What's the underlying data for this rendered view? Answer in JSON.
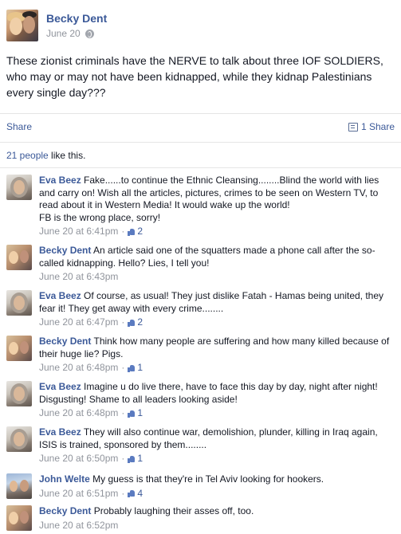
{
  "post": {
    "author": "Becky Dent",
    "date": "June 20",
    "privacy_icon": "globe-icon",
    "text": "These zionist criminals have the NERVE to talk about three IOF SOLDIERS, who may or may not have been kidnapped, while they kidnap Palestinians every single day???",
    "share_label": "Share",
    "share_count": "1 Share",
    "likes_link": "21 people",
    "likes_rest": " like this."
  },
  "comments": [
    {
      "author": "Eva Beez",
      "text": "Fake......to continue the Ethnic Cleansing........Blind the world with lies and carry on! Wish all the articles, pictures, crimes to be seen on Western TV, to read about it in Western Media! It would wake up the world!\nFB is the wrong place, sorry!",
      "time": "June 20 at 6:41pm",
      "likes": "2"
    },
    {
      "author": "Becky Dent",
      "text": "An article said one of the squatters made a phone call after the so-called kidnapping. Hello? Lies, I tell you!",
      "time": "June 20 at 6:43pm",
      "likes": ""
    },
    {
      "author": "Eva Beez",
      "text": "Of course, as usual! They just dislike Fatah - Hamas being united, they fear it! They get away with every crime........",
      "time": "June 20 at 6:47pm",
      "likes": "2"
    },
    {
      "author": "Becky Dent",
      "text": "Think how many people are suffering and how many killed because of their huge lie? Pigs.",
      "time": "June 20 at 6:48pm",
      "likes": "1"
    },
    {
      "author": "Eva Beez",
      "text": "Imagine u do live there, have to face this day by day, night after night! Disgusting! Shame to all leaders looking aside!",
      "time": "June 20 at 6:48pm",
      "likes": "1"
    },
    {
      "author": "Eva Beez",
      "text": "They will also continue war, demolishion, plunder, killing in Iraq again, ISIS is trained, sponsored by them........",
      "time": "June 20 at 6:50pm",
      "likes": "1"
    },
    {
      "author": "John Welte",
      "text": "My guess is that they're in Tel Aviv looking for hookers.",
      "time": "June 20 at 6:51pm",
      "likes": "4"
    },
    {
      "author": "Becky Dent",
      "text": "Probably laughing their asses off, too.",
      "time": "June 20 at 6:52pm",
      "likes": ""
    }
  ],
  "colors": {
    "link": "#3b5998",
    "text": "#141823",
    "meta": "#90949c"
  }
}
